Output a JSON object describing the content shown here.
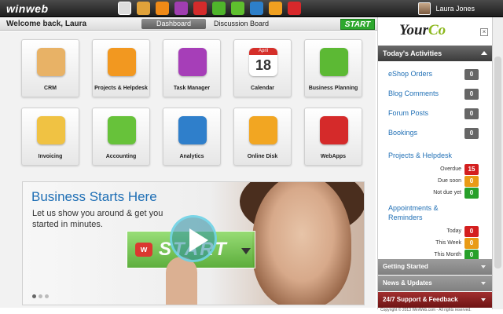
{
  "topbar": {
    "logo": "winweb",
    "user_name": "Laura Jones",
    "icons": [
      {
        "name": "dashboard-icon",
        "color": "#dddddd"
      },
      {
        "name": "crm-icon",
        "color": "#e0a23a"
      },
      {
        "name": "projects-icon",
        "color": "#f08a17"
      },
      {
        "name": "task-manager-icon",
        "color": "#a03eb0"
      },
      {
        "name": "calendar-icon",
        "color": "#d42b2b"
      },
      {
        "name": "business-planning-icon",
        "color": "#4fb52b"
      },
      {
        "name": "accounting-icon",
        "color": "#5fbf2e"
      },
      {
        "name": "analytics-icon",
        "color": "#2d7fc9"
      },
      {
        "name": "online-disk-icon",
        "color": "#f0a020"
      },
      {
        "name": "webapps-icon",
        "color": "#d8282b"
      }
    ]
  },
  "subbar": {
    "welcome": "Welcome back, Laura",
    "tabs": [
      "Dashboard",
      "Discussion Board"
    ],
    "start": "START"
  },
  "apps": [
    {
      "label": "CRM",
      "name": "crm",
      "color": "#e8b266"
    },
    {
      "label": "Projects & Helpdesk",
      "name": "projects-helpdesk",
      "color": "#f29820"
    },
    {
      "label": "Task Manager",
      "name": "task-manager",
      "color": "#a63eb8"
    },
    {
      "label": "Calendar",
      "name": "calendar",
      "color": "#d52f2a"
    },
    {
      "label": "Business Planning",
      "name": "business-planning",
      "color": "#5cb934"
    },
    {
      "label": "Invoicing",
      "name": "invoicing",
      "color": "#f0c243"
    },
    {
      "label": "Accounting",
      "name": "accounting",
      "color": "#67c23a"
    },
    {
      "label": "Analytics",
      "name": "analytics",
      "color": "#2f7fcb"
    },
    {
      "label": "Online Disk",
      "name": "online-disk",
      "color": "#f2a622"
    },
    {
      "label": "WebApps",
      "name": "webapps",
      "color": "#d52a2a"
    }
  ],
  "calendar_month": "April",
  "calendar_day": "18",
  "banner": {
    "title": "Business Starts Here",
    "subtitle": "Let us show you around & get you started in minutes.",
    "start": "START",
    "logo_letter": "w"
  },
  "sidebar": {
    "brand_a": "Your",
    "brand_b": "Co",
    "activities_title": "Today's Activities",
    "items": [
      {
        "label": "eShop Orders",
        "count": "0"
      },
      {
        "label": "Blog Comments",
        "count": "0"
      },
      {
        "label": "Forum Posts",
        "count": "0"
      },
      {
        "label": "Bookings",
        "count": "0"
      }
    ],
    "projects_title": "Projects & Helpdesk",
    "projects": [
      {
        "label": "Overdue",
        "count": "15",
        "color": "red"
      },
      {
        "label": "Due soon",
        "count": "0",
        "color": "orange"
      },
      {
        "label": "Not due yet",
        "count": "0",
        "color": "green"
      }
    ],
    "appointments_title": "Appointments & Reminders",
    "appointments": [
      {
        "label": "Today",
        "count": "0",
        "color": "red"
      },
      {
        "label": "This Week",
        "count": "0",
        "color": "orange"
      },
      {
        "label": "This Month",
        "count": "0",
        "color": "green"
      }
    ],
    "bottom": [
      "Getting Started",
      "News & Updates",
      "24/7 Support & Feedback"
    ]
  },
  "footer": "Copyright © 2013 WinWeb.com - All rights reserved."
}
